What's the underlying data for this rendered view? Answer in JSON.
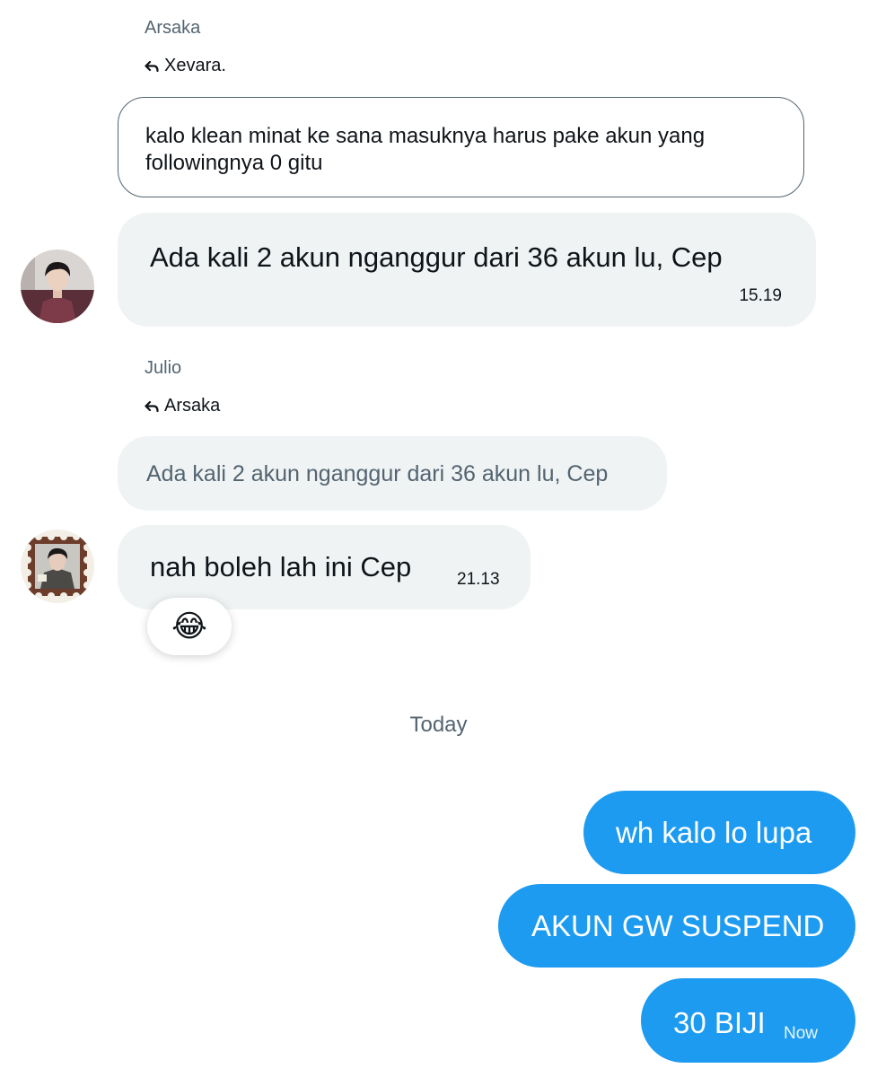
{
  "thread": {
    "group1": {
      "sender": "Arsaka",
      "reply_to": "Xevara.",
      "quoted_text": "kalo klean minat ke sana masuknya harus pake akun yang followingnya 0 gitu",
      "message": "Ada kali 2 akun nganggur dari 36 akun lu, Cep",
      "time": "15.19",
      "avatar_icon": "avatar-arsaka"
    },
    "group2": {
      "sender": "Julio",
      "reply_to": "Arsaka",
      "quoted_text": "Ada kali 2 akun nganggur dari 36 akun lu, Cep",
      "message": "nah boleh lah ini Cep",
      "time": "21.13",
      "reaction": "😂",
      "avatar_icon": "avatar-julio"
    },
    "date_separator": "Today",
    "sent": [
      {
        "text": "wh kalo lo lupa"
      },
      {
        "text": "AKUN GW SUSPEND"
      },
      {
        "text": "30 BIJI",
        "time": "Now"
      }
    ]
  },
  "colors": {
    "accent_blue": "#1d9bf0",
    "bubble_gray": "#eff3f4",
    "secondary_text": "#536471"
  }
}
